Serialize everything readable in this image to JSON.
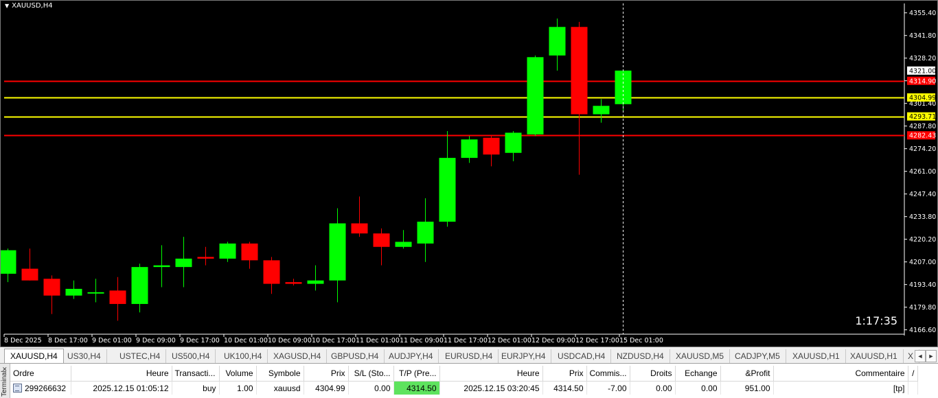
{
  "chart": {
    "title": "XAUUSD,H4",
    "countdown": "1:17:35",
    "colors": {
      "background": "#000000",
      "bull": "#00ff00",
      "bear": "#ff0000",
      "axis": "#ffffff"
    },
    "price_ticks": [
      "4355.40",
      "4341.80",
      "4328.20",
      "4314.60",
      "4301.40",
      "4287.80",
      "4274.20",
      "4261.00",
      "4247.40",
      "4233.80",
      "4220.20",
      "4207.00",
      "4193.40",
      "4179.80",
      "4166.60"
    ],
    "time_ticks": [
      "8 Dec 2025",
      "8 Dec 17:00",
      "9 Dec 01:00",
      "9 Dec 09:00",
      "9 Dec 17:00",
      "10 Dec 01:00",
      "10 Dec 09:00",
      "10 Dec 17:00",
      "11 Dec 01:00",
      "11 Dec 09:00",
      "11 Dec 17:00",
      "12 Dec 01:00",
      "12 Dec 09:00",
      "12 Dec 17:00",
      "15 Dec 01:00"
    ],
    "price_labels": [
      {
        "text": "4321.00",
        "price": 4321.0,
        "bg": "#ffffff",
        "fg": "#000000",
        "line": ""
      },
      {
        "text": "4314.90",
        "price": 4314.9,
        "bg": "#ff0000",
        "fg": "#ffffff",
        "line": "#ff0000"
      },
      {
        "text": "4304.99",
        "price": 4304.99,
        "bg": "#ffff00",
        "fg": "#000000",
        "line": "#ffff00"
      },
      {
        "text": "4293.71",
        "price": 4293.71,
        "bg": "#ffff00",
        "fg": "#000000",
        "line": "#ffff00"
      },
      {
        "text": "4282.43",
        "price": 4282.43,
        "bg": "#ff0000",
        "fg": "#ffffff",
        "line": "#ff0000"
      }
    ],
    "current_bar_index": 28,
    "candles": [
      {
        "o": 4200.0,
        "h": 4215.0,
        "l": 4195.0,
        "c": 4214.0
      },
      {
        "o": 4203.0,
        "h": 4215.0,
        "l": 4196.0,
        "c": 4196.0
      },
      {
        "o": 4197.0,
        "h": 4199.0,
        "l": 4176.0,
        "c": 4187.0
      },
      {
        "o": 4187.0,
        "h": 4196.0,
        "l": 4185.0,
        "c": 4191.0
      },
      {
        "o": 4189.0,
        "h": 4197.0,
        "l": 4183.0,
        "c": 4189.0
      },
      {
        "o": 4190.0,
        "h": 4198.0,
        "l": 4172.0,
        "c": 4182.0
      },
      {
        "o": 4182.0,
        "h": 4206.0,
        "l": 4177.0,
        "c": 4204.0
      },
      {
        "o": 4204.0,
        "h": 4217.0,
        "l": 4192.0,
        "c": 4205.0
      },
      {
        "o": 4204.0,
        "h": 4222.0,
        "l": 4192.0,
        "c": 4209.0
      },
      {
        "o": 4210.0,
        "h": 4216.0,
        "l": 4205.0,
        "c": 4209.0
      },
      {
        "o": 4209.0,
        "h": 4219.0,
        "l": 4207.0,
        "c": 4218.0
      },
      {
        "o": 4218.0,
        "h": 4219.0,
        "l": 4203.0,
        "c": 4208.0
      },
      {
        "o": 4208.0,
        "h": 4210.0,
        "l": 4188.0,
        "c": 4194.0
      },
      {
        "o": 4195.0,
        "h": 4197.0,
        "l": 4193.0,
        "c": 4194.0
      },
      {
        "o": 4194.0,
        "h": 4205.0,
        "l": 4190.0,
        "c": 4196.0
      },
      {
        "o": 4196.0,
        "h": 4239.0,
        "l": 4183.0,
        "c": 4230.0
      },
      {
        "o": 4230.0,
        "h": 4246.0,
        "l": 4222.0,
        "c": 4224.0
      },
      {
        "o": 4224.0,
        "h": 4227.0,
        "l": 4205.0,
        "c": 4216.0
      },
      {
        "o": 4216.0,
        "h": 4226.0,
        "l": 4215.0,
        "c": 4219.0
      },
      {
        "o": 4218.0,
        "h": 4245.0,
        "l": 4207.0,
        "c": 4231.0
      },
      {
        "o": 4231.0,
        "h": 4285.0,
        "l": 4228.0,
        "c": 4269.0
      },
      {
        "o": 4269.0,
        "h": 4282.0,
        "l": 4266.0,
        "c": 4280.0
      },
      {
        "o": 4281.0,
        "h": 4282.0,
        "l": 4264.0,
        "c": 4271.0
      },
      {
        "o": 4272.0,
        "h": 4285.0,
        "l": 4267.0,
        "c": 4284.0
      },
      {
        "o": 4283.0,
        "h": 4330.0,
        "l": 4282.0,
        "c": 4329.0
      },
      {
        "o": 4330.0,
        "h": 4352.0,
        "l": 4321.0,
        "c": 4347.0
      },
      {
        "o": 4347.0,
        "h": 4350.0,
        "l": 4259.0,
        "c": 4295.0
      },
      {
        "o": 4295.0,
        "h": 4304.0,
        "l": 4290.0,
        "c": 4300.0
      },
      {
        "o": 4301.0,
        "h": 4321.0,
        "l": 4296.0,
        "c": 4321.0
      }
    ]
  },
  "tabs": {
    "items": [
      "XAUUSD,H4",
      "US30,H4",
      "USTEC,H4",
      "US500,H4",
      "UK100,H4",
      "XAGUSD,H4",
      "GBPUSD,H4",
      "AUDJPY,H4",
      "EURUSD,H4",
      "EURJPY,H4",
      "USDCAD,H4",
      "NZDUSD,H4",
      "XAUUSD,M5",
      "CADJPY,M5",
      "XAUUSD,H1",
      "XAUUSD,H1",
      "X"
    ],
    "active_index": 0,
    "scroll_left": "◄",
    "scroll_right": "►"
  },
  "terminal": {
    "side_label": "Terminal",
    "close_glyph": "✕",
    "columns": [
      "Ordre",
      "Heure",
      "Transacti...",
      "Volume",
      "Symbole",
      "Prix",
      "S/L (Sto...",
      "T/P (Pre...",
      "Heure",
      "Prix",
      "Commis...",
      "Droits",
      "Echange",
      "&Profit",
      "Commentaire",
      "/"
    ],
    "rows": [
      {
        "order": "299266632",
        "open_time": "2025.12.15 01:05:12",
        "type": "buy",
        "volume": "1.00",
        "symbol": "xauusd",
        "open_price": "4304.99",
        "sl": "0.00",
        "tp": "4314.50",
        "time": "2025.12.15 03:20:45",
        "price": "4314.50",
        "commission": "-7.00",
        "rights": "0.00",
        "swap": "0.00",
        "profit": "951.00",
        "comment": "[tp]"
      }
    ]
  }
}
